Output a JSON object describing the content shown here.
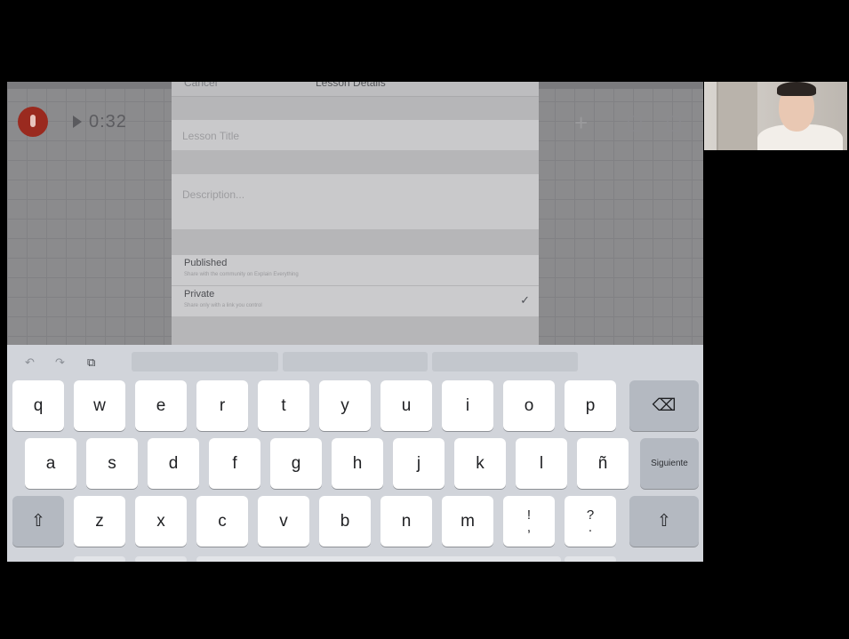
{
  "app": {
    "timer": "0:32",
    "sheet": {
      "nav_cancel": "Cancel",
      "nav_title": "Lesson Details",
      "title_placeholder": "Lesson Title",
      "description_placeholder": "Description...",
      "options": [
        {
          "label": "Published",
          "sublabel": "Share with the community on Explain Everything",
          "checked": false
        },
        {
          "label": "Private",
          "sublabel": "Share only with a link you control",
          "checked": true
        }
      ]
    }
  },
  "keyboard": {
    "row1": [
      "q",
      "w",
      "e",
      "r",
      "t",
      "y",
      "u",
      "i",
      "o",
      "p"
    ],
    "row2": [
      "a",
      "s",
      "d",
      "f",
      "g",
      "h",
      "j",
      "k",
      "l",
      "ñ"
    ],
    "row3": [
      "z",
      "x",
      "c",
      "v",
      "b",
      "n",
      "m"
    ],
    "next_label": "Siguiente",
    "punct1": {
      "top": "!",
      "bottom": ","
    },
    "punct2": {
      "top": "?",
      "bottom": "."
    }
  },
  "icons": {
    "record": "microphone-icon",
    "play": "play-icon",
    "add": "plus-icon",
    "undo": "undo-icon",
    "redo": "redo-icon",
    "paste": "paste-icon",
    "backspace": "backspace-icon",
    "shift": "shift-icon",
    "check": "checkmark-icon"
  }
}
